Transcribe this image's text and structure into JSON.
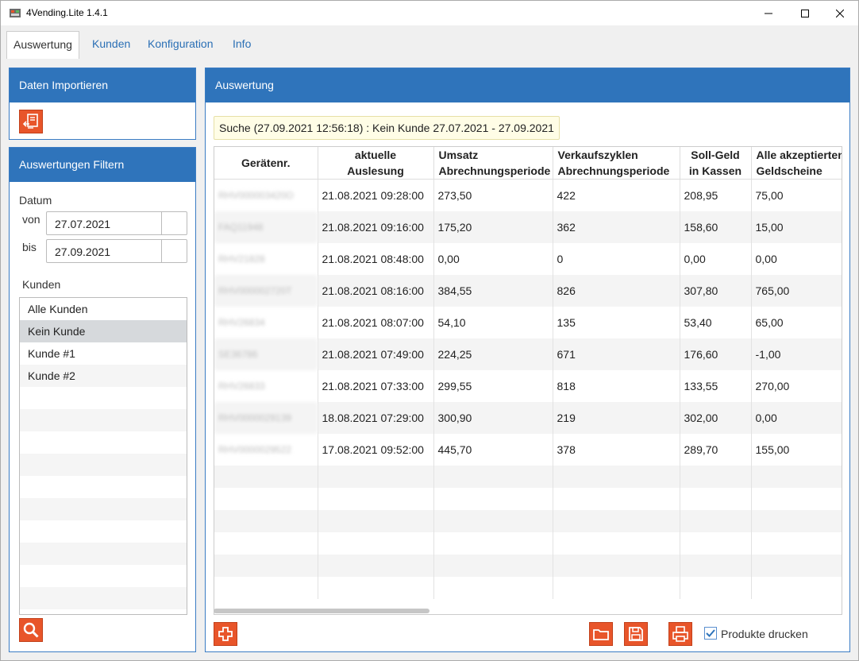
{
  "window": {
    "title": "4Vending.Lite 1.4.1"
  },
  "tabs": [
    {
      "label": "Auswertung"
    },
    {
      "label": "Kunden"
    },
    {
      "label": "Konfiguration"
    },
    {
      "label": "Info"
    }
  ],
  "import_panel": {
    "title": "Daten Importieren"
  },
  "filter_panel": {
    "title": "Auswertungen Filtern",
    "date_label": "Datum",
    "from_label": "von",
    "from_value": "27.07.2021",
    "to_label": "bis",
    "to_value": "27.09.2021",
    "customers_label": "Kunden",
    "customers": [
      "Alle Kunden",
      "Kein Kunde",
      "Kunde #1",
      "Kunde #2"
    ],
    "selected_customer": "Kein Kunde"
  },
  "report_panel": {
    "title": "Auswertung",
    "search_summary": "Suche (27.09.2021 12:56:18) : Kein Kunde 27.07.2021 - 27.09.2021",
    "columns": [
      {
        "line1": "Gerätenr.",
        "line2": ""
      },
      {
        "line1": "aktuelle",
        "line2": "Auslesung"
      },
      {
        "line1": "Umsatz",
        "line2": "Abrechnungsperiode"
      },
      {
        "line1": "Verkaufszyklen",
        "line2": "Abrechnungsperiode"
      },
      {
        "line1": "Soll-Geld",
        "line2": "in Kassen"
      },
      {
        "line1": "Alle akzeptierten",
        "line2": "Geldscheine"
      }
    ],
    "rows": [
      [
        "RHV000003420O",
        "21.08.2021 09:28:00",
        "273,50",
        "422",
        "208,95",
        "75,00"
      ],
      [
        "FAQ11948",
        "21.08.2021 09:16:00",
        "175,20",
        "362",
        "158,60",
        "15,00"
      ],
      [
        "RHV21828",
        "21.08.2021 08:48:00",
        "0,00",
        "0",
        "0,00",
        "0,00"
      ],
      [
        "RHV000002720T",
        "21.08.2021 08:16:00",
        "384,55",
        "826",
        "307,80",
        "765,00"
      ],
      [
        "RHV26834",
        "21.08.2021 08:07:00",
        "54,10",
        "135",
        "53,40",
        "65,00"
      ],
      [
        "SE36786",
        "21.08.2021 07:49:00",
        "224,25",
        "671",
        "176,60",
        "-1,00"
      ],
      [
        "RHV26833",
        "21.08.2021 07:33:00",
        "299,55",
        "818",
        "133,55",
        "270,00"
      ],
      [
        "RHV0000029139",
        "18.08.2021 07:29:00",
        "300,90",
        "219",
        "302,00",
        "0,00"
      ],
      [
        "RHV0000029522",
        "17.08.2021 09:52:00",
        "445,70",
        "378",
        "289,70",
        "155,00"
      ]
    ],
    "print_products_label": "Produkte drucken",
    "print_products_checked": true
  }
}
